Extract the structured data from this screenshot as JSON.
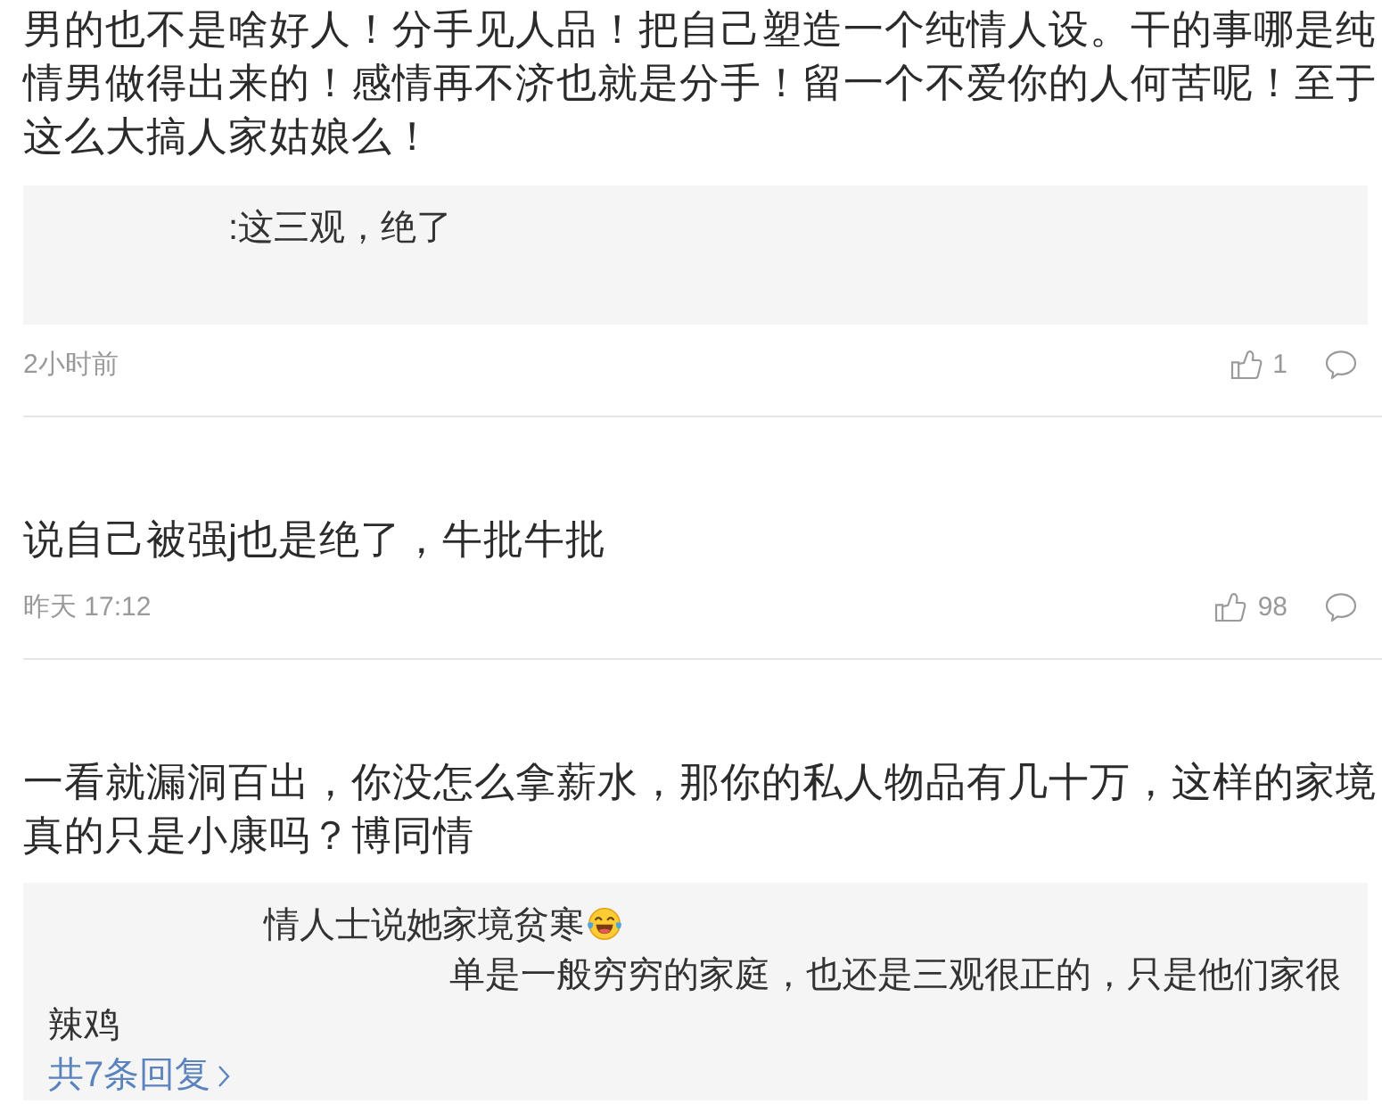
{
  "comments": [
    {
      "text": "男的也不是啥好人！分手见人品！把自己塑造一个纯情人设。干的事哪是纯情男做得出来的！感情再不济也就是分手！留一个不爱你的人何苦呢！至于这么大搞人家姑娘么！",
      "replies": [
        {
          "text": ":这三观，绝了",
          "emoji": false
        }
      ],
      "time": "2小时前",
      "likes": "1"
    },
    {
      "text": "说自己被强j也是绝了，牛批牛批",
      "time": "昨天 17:12",
      "likes": "98"
    },
    {
      "text": "一看就漏洞百出，你没怎么拿薪水，那你的私人物品有几十万，这样的家境真的只是小康吗？博同情",
      "replies": [
        {
          "text": "情人士说她家境贫寒",
          "emoji": true
        },
        {
          "text": "单是一般穷穷的家庭，也还是三观很正的，只是他们家很辣鸡",
          "emoji": false
        }
      ],
      "more_replies": "共7条回复"
    }
  ]
}
